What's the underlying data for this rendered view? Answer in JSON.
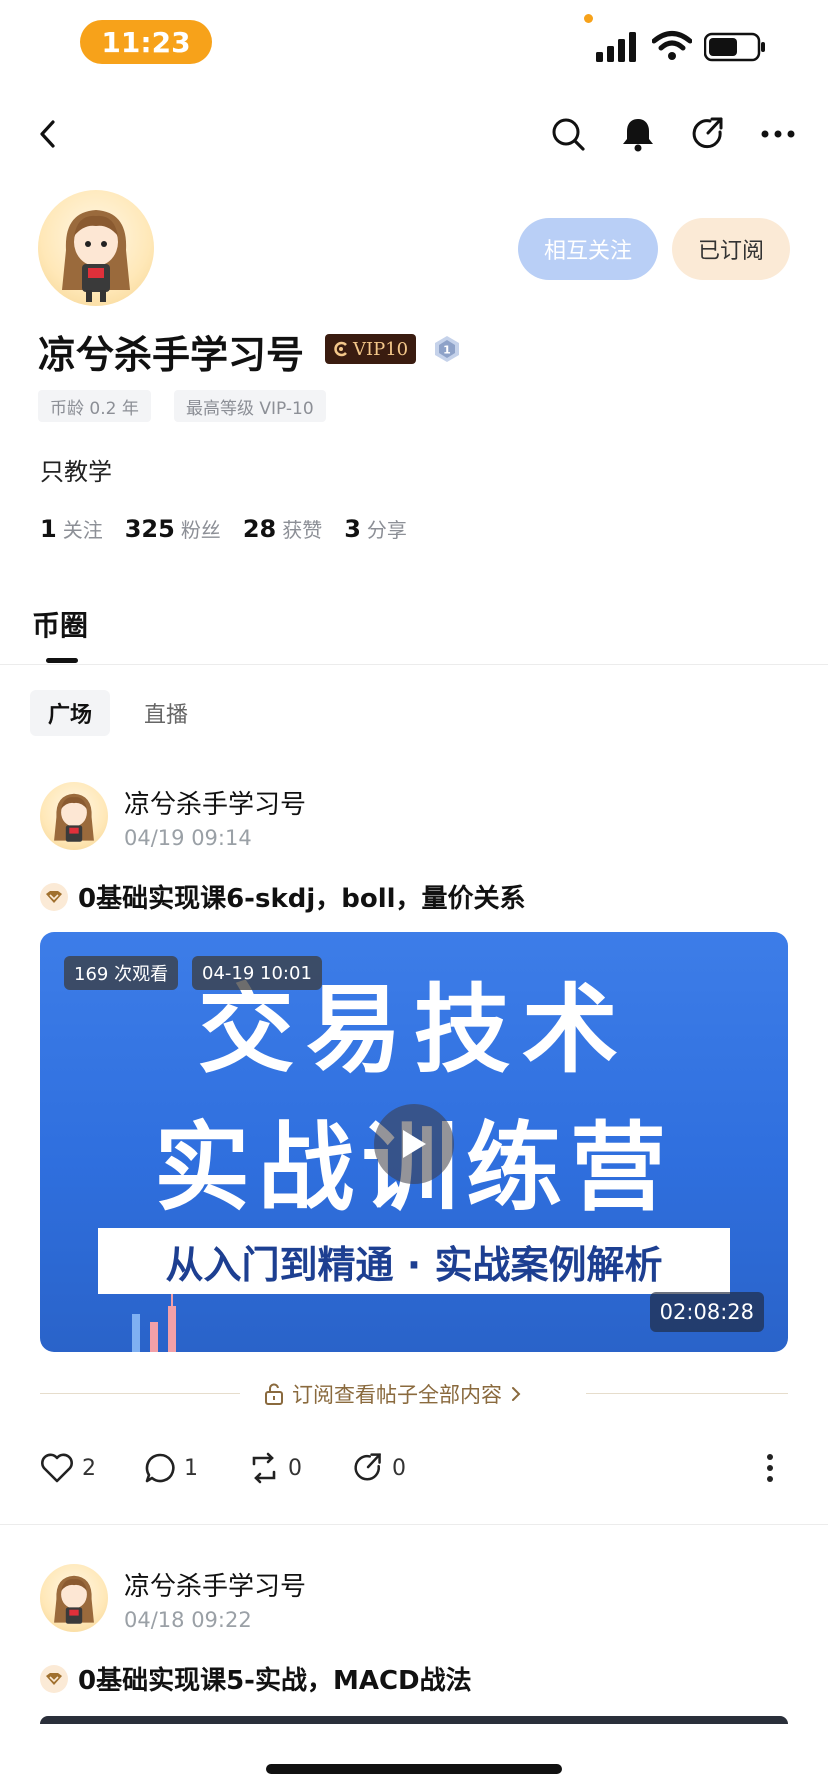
{
  "status_bar": {
    "time": "11:23"
  },
  "profile": {
    "name": "凉兮杀手学习号",
    "vip_badge": "VIP10",
    "level_badge": "1",
    "tags": [
      "币龄 0.2 年",
      "最高等级 VIP-10"
    ],
    "bio": "只教学",
    "buttons": {
      "mutual_follow": "相互关注",
      "subscribed": "已订阅"
    },
    "stats": [
      {
        "value": "1",
        "label": "关注"
      },
      {
        "value": "325",
        "label": "粉丝"
      },
      {
        "value": "28",
        "label": "获赞"
      },
      {
        "value": "3",
        "label": "分享"
      }
    ]
  },
  "section": {
    "title": "币圈"
  },
  "subtabs": [
    "广场",
    "直播"
  ],
  "posts": [
    {
      "author": "凉兮杀手学习号",
      "date": "04/19 09:14",
      "title": "0基础实现课6-skdj，boll，量价关系",
      "video": {
        "views": "169 次观看",
        "timestamp": "04-19 10:01",
        "headline_line1": "交易技术",
        "headline_line2": "实战训练营",
        "banner": "从入门到精通 · 实战案例解析",
        "duration": "02:08:28"
      },
      "subscribe_prompt": "订阅查看帖子全部内容",
      "actions": {
        "likes": "2",
        "comments": "1",
        "reposts": "0",
        "shares": "0"
      }
    },
    {
      "author": "凉兮杀手学习号",
      "date": "04/18 09:22",
      "title": "0基础实现课5-实战，MACD战法"
    }
  ],
  "colors": {
    "accent_orange": "#f7a21a",
    "mutual_button": "#b9cff6",
    "subscribed_button": "#fbead6",
    "video_blue": "#2f6fde"
  }
}
